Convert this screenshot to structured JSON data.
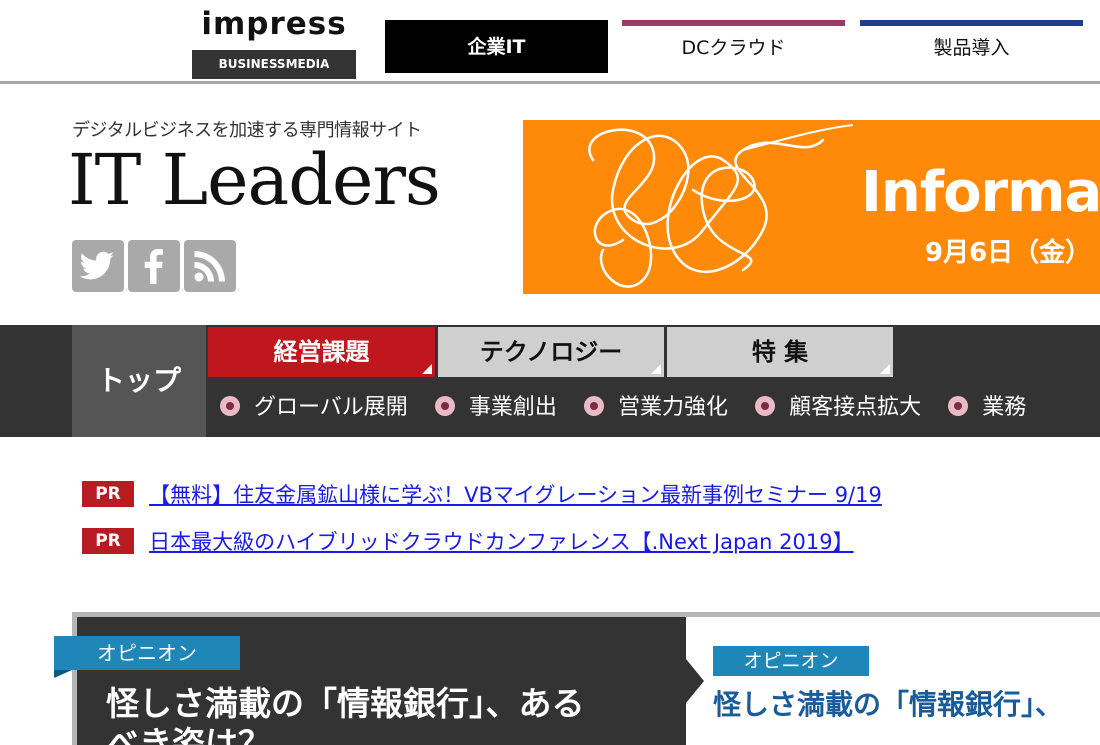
{
  "topbar": {
    "logo_word": "impress",
    "logo_sub": "BUSINESSMEDIA",
    "tabs": [
      {
        "label": "企業IT"
      },
      {
        "label": "DCクラウド"
      },
      {
        "label": "製品導入"
      }
    ],
    "colors": {
      "dc_accent": "#9a3a66",
      "seihin_accent": "#1f3d8f"
    }
  },
  "header": {
    "tagline": "デジタルビジネスを加速する専門情報サイト",
    "logo": "IT Leaders",
    "social": [
      "twitter-icon",
      "facebook-icon",
      "rss-icon"
    ]
  },
  "banner": {
    "title": "Informat",
    "date": "9月6日（金）",
    "color": "#ff8a0a"
  },
  "nav": {
    "top": "トップ",
    "tabs": [
      {
        "label": "経営課題"
      },
      {
        "label": "テクノロジー"
      },
      {
        "label": "特 集"
      }
    ],
    "sub_items": [
      {
        "label": "グローバル展開"
      },
      {
        "label": "事業創出"
      },
      {
        "label": "営業力強化"
      },
      {
        "label": "顧客接点拡大"
      },
      {
        "label": "業務"
      }
    ],
    "colors": {
      "active": "#c0171f",
      "inactive": "#cfcfcf"
    }
  },
  "pr": {
    "badge": "PR",
    "links": [
      {
        "text": "【無料】住友金属鉱山様に学ぶ！VBマイグレーション最新事例セミナー 9/19"
      },
      {
        "text": "日本最大級のハイブリッドクラウドカンファレンス【.Next Japan 2019】"
      }
    ]
  },
  "feature": {
    "main_tag": "オピニオン",
    "main_title_line1": "怪しさ満載の「情報銀行」、ある",
    "main_title_line2": "べき姿は？",
    "side_tag": "オピニオン",
    "side_title": "怪しさ満載の「情報銀行」、"
  }
}
